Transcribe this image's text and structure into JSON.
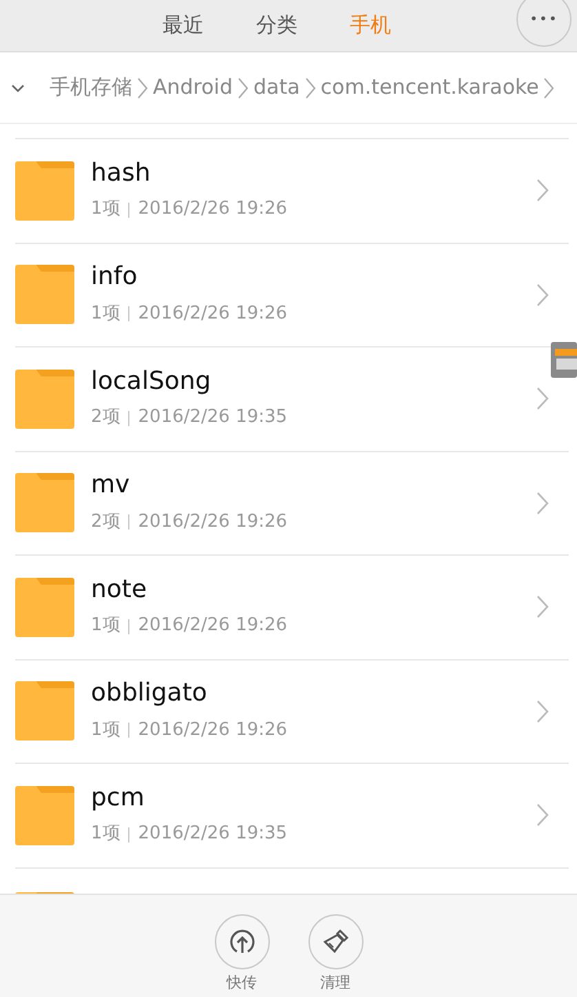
{
  "tabs": [
    {
      "label": "最近",
      "selected": false
    },
    {
      "label": "分类",
      "selected": false
    },
    {
      "label": "手机",
      "selected": true
    }
  ],
  "more_button": {
    "label": "•••"
  },
  "breadcrumb": [
    "手机存储",
    "Android",
    "data",
    "com.tencent.karaoke"
  ],
  "folders": [
    {
      "name": "hash",
      "count": "1项",
      "date": "2016/2/26 19:26"
    },
    {
      "name": "info",
      "count": "1项",
      "date": "2016/2/26 19:26"
    },
    {
      "name": "localSong",
      "count": "2项",
      "date": "2016/2/26 19:35"
    },
    {
      "name": "mv",
      "count": "2项",
      "date": "2016/2/26 19:26"
    },
    {
      "name": "note",
      "count": "1项",
      "date": "2016/2/26 19:26"
    },
    {
      "name": "obbligato",
      "count": "1项",
      "date": "2016/2/26 19:26"
    },
    {
      "name": "pcm",
      "count": "1项",
      "date": "2016/2/26 19:35"
    }
  ],
  "bottom_actions": [
    {
      "kind": "upload",
      "label": "快传"
    },
    {
      "kind": "clean",
      "label": "清理"
    }
  ]
}
